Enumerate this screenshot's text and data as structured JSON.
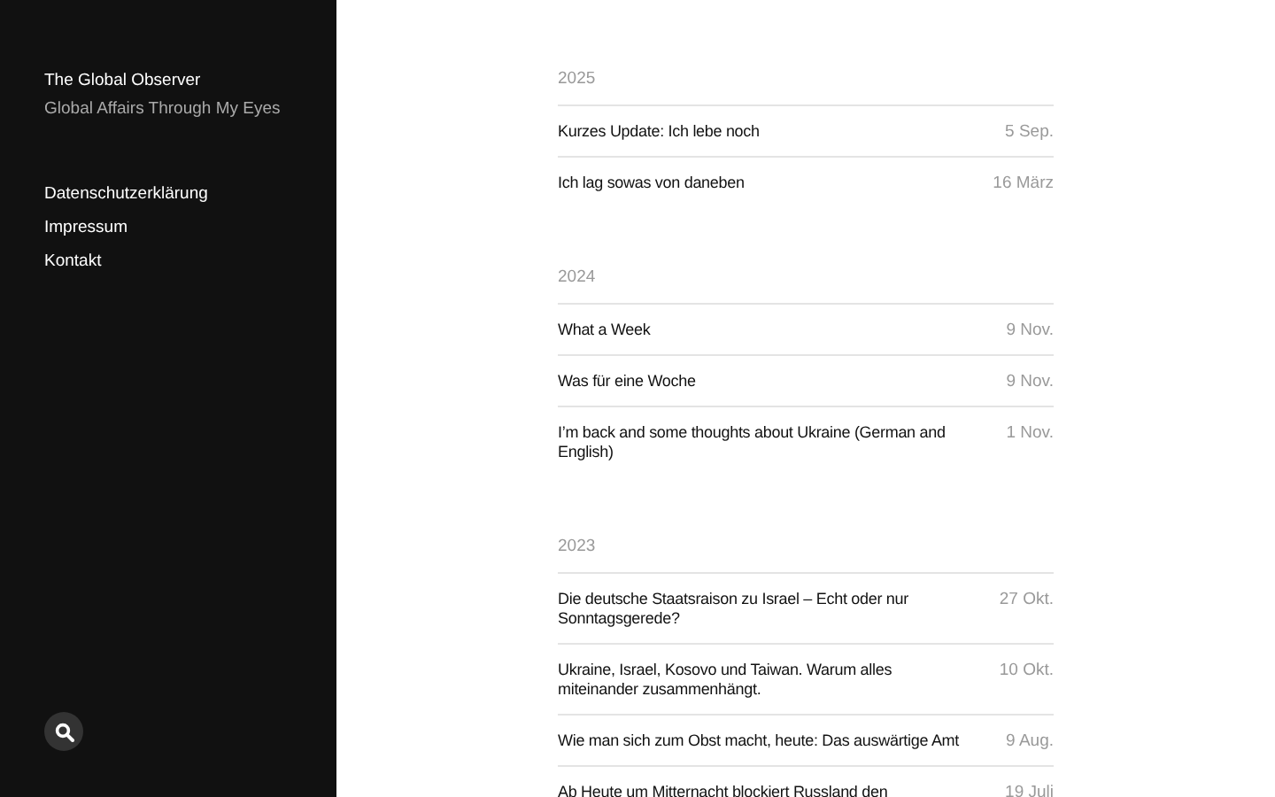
{
  "site": {
    "title": "The Global Observer",
    "tagline": "Global Affairs Through My Eyes"
  },
  "nav": [
    {
      "label": "Datenschutzerklärung"
    },
    {
      "label": "Impressum"
    },
    {
      "label": "Kontakt"
    }
  ],
  "archive": [
    {
      "year": "2025",
      "posts": [
        {
          "title": "Kurzes Update: Ich lebe noch",
          "date": "5 Sep."
        },
        {
          "title": "Ich lag sowas von daneben",
          "date": "16 März"
        }
      ]
    },
    {
      "year": "2024",
      "posts": [
        {
          "title": "What a Week",
          "date": "9 Nov."
        },
        {
          "title": "Was für eine Woche",
          "date": "9 Nov."
        },
        {
          "title": "I’m back and some thoughts about Ukraine (German and English)",
          "date": "1 Nov."
        }
      ]
    },
    {
      "year": "2023",
      "posts": [
        {
          "title": "Die deutsche Staatsraison zu Israel – Echt oder nur Sonntagsgerede?",
          "date": "27 Okt."
        },
        {
          "title": "Ukraine, Israel, Kosovo und Taiwan. Warum alles miteinander zusammenhängt.",
          "date": "10 Okt."
        },
        {
          "title": "Wie man sich zum Obst macht, heute: Das auswärtige Amt",
          "date": "9 Aug."
        },
        {
          "title": "Ab Heute um Mitternacht blockiert Russland den",
          "date": "19 Juli"
        }
      ]
    }
  ]
}
